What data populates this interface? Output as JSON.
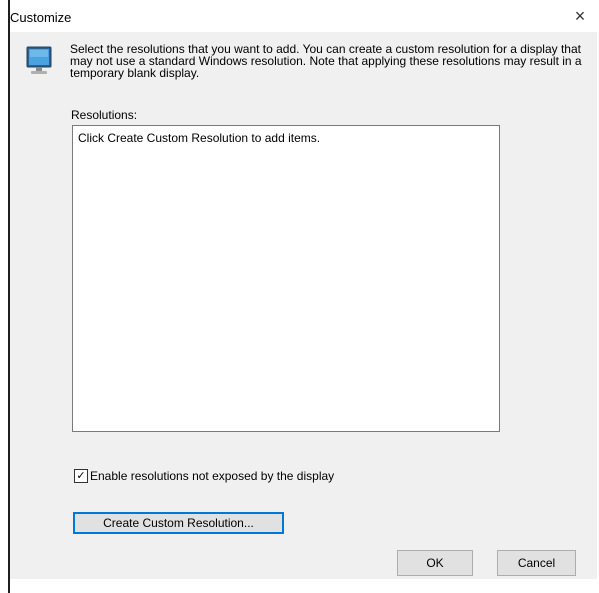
{
  "window": {
    "title": "Customize",
    "close_glyph": "×"
  },
  "header": {
    "icon": "monitor-icon",
    "description": "Select the resolutions that you want to add. You can create a custom resolution for a display that may not use a standard Windows resolution. Note that applying these resolutions may result in a temporary blank display."
  },
  "resolutions": {
    "label": "Resolutions:",
    "placeholder": "Click Create Custom Resolution to add items.",
    "items": []
  },
  "options": {
    "enable_unexposed_label": "Enable resolutions not exposed by the display",
    "enable_unexposed_checked": true,
    "check_glyph": "✓"
  },
  "buttons": {
    "create_label": "Create Custom Resolution...",
    "ok_label": "OK",
    "cancel_label": "Cancel"
  },
  "colors": {
    "dialog_bg": "#f0f0f0",
    "focus_border": "#0078d7"
  }
}
